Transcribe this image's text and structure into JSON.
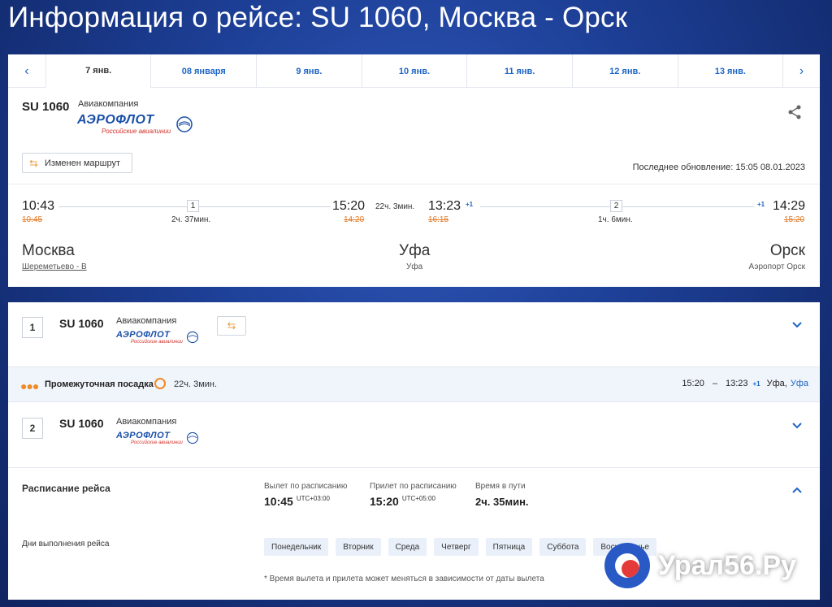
{
  "page_title": "Информация о рейсе: SU 1060, Москва - Орск",
  "date_tabs": [
    "7 янв.",
    "08 января",
    "9 янв.",
    "10 янв.",
    "11 янв.",
    "12 янв.",
    "13 янв."
  ],
  "active_tab_index": 0,
  "summary": {
    "flight_no": "SU 1060",
    "airline_label": "Авиакомпания",
    "airline_logo": "АЭРОФЛОТ",
    "airline_logo_sub": "Российские авиалинии",
    "route_changed_label": "Изменен маршрут",
    "last_update": "Последнее обновление: 15:05 08.01.2023"
  },
  "timeline": {
    "dep_time": "10:43",
    "dep_old": "10:45",
    "seg1_no": "1",
    "seg1_dur": "2ч. 37мин.",
    "arr1_time": "15:20",
    "arr1_old": "14:20",
    "layover": "22ч. 3мин.",
    "dep2_time": "13:23",
    "dep2_old": "16:15",
    "dep2_plus": "+1",
    "seg2_no": "2",
    "seg2_dur": "1ч. 6мин.",
    "arr_plus": "+1",
    "arr_time": "14:29",
    "arr_old": "15:20"
  },
  "cities": {
    "from_city": "Москва",
    "from_airport": "Шереметьево - B",
    "via_city": "Уфа",
    "via_airport": "Уфа",
    "to_city": "Орск",
    "to_airport": "Аэропорт Орск"
  },
  "segments": [
    {
      "num": "1",
      "flight_no": "SU 1060",
      "airline_label": "Авиакомпания"
    },
    {
      "num": "2",
      "flight_no": "SU 1060",
      "airline_label": "Авиакомпания"
    }
  ],
  "stopover": {
    "label": "Промежуточная посадка",
    "duration": "22ч. 3мин.",
    "from_time": "15:20",
    "dash": "–",
    "to_time": "13:23",
    "plus": "+1",
    "city": "Уфа,",
    "airport": "Уфа"
  },
  "schedule": {
    "title": "Расписание рейса",
    "dep_label": "Вылет по расписанию",
    "dep_value": "10:45",
    "dep_utc": "UTC+03:00",
    "arr_label": "Прилет по расписанию",
    "arr_value": "15:20",
    "arr_utc": "UTC+05:00",
    "dur_label": "Время в пути",
    "dur_value": "2ч. 35мин.",
    "days_label": "Дни выполнения рейса",
    "days": [
      "Понедельник",
      "Вторник",
      "Среда",
      "Четверг",
      "Пятница",
      "Суббота",
      "Воскресенье"
    ],
    "footnote": "* Время вылета и прилета может меняться в зависимости от даты вылета"
  },
  "watermark": "Урал56.Ру",
  "colors": {
    "accent": "#1f66c4",
    "warning": "#e27b28",
    "brand_red": "#d0322b"
  }
}
